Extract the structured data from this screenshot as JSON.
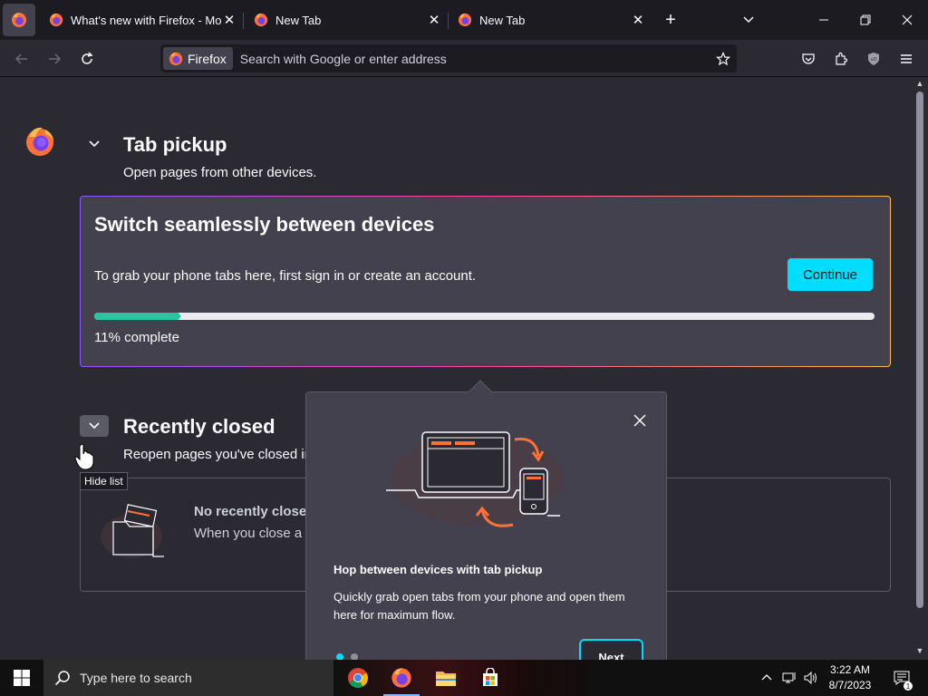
{
  "tabs": [
    {
      "title": "What's new with Firefox - More",
      "close": "✕"
    },
    {
      "title": "New Tab",
      "close": "✕"
    },
    {
      "title": "New Tab",
      "close": "✕"
    }
  ],
  "tabstrip": {
    "new_tab": "+",
    "list_tabs": "⌄"
  },
  "window": {
    "minimize": "—",
    "restore": "❐",
    "close": "✕"
  },
  "navbar": {
    "identity_label": "Firefox",
    "url_placeholder": "Search with Google or enter address",
    "url_value": ""
  },
  "tab_pickup": {
    "title": "Tab pickup",
    "subtitle": "Open pages from other devices.",
    "card_title": "Switch seamlessly between devices",
    "card_text": "To grab your phone tabs here, first sign in or create an account.",
    "continue_label": "Continue",
    "progress_text": "11% complete",
    "progress_fraction": 0.11
  },
  "recently_closed": {
    "title": "Recently closed",
    "subtitle": "Reopen pages you've closed in",
    "empty_title": "No recently closed",
    "empty_sub": "When you close a t"
  },
  "tooltip": "Hide list",
  "popup": {
    "title": "Hop between devices with tab pickup",
    "body": "Quickly grab open tabs from your phone and open them here for maximum flow.",
    "next_label": "Next",
    "step": 1,
    "steps": 2
  },
  "taskbar": {
    "search_placeholder": "Type here to search",
    "time": "3:22 AM",
    "date": "8/7/2023"
  },
  "colors": {
    "accent": "#00ddff",
    "progress": "#2ac3a2",
    "firefox_orange": "#ff7139"
  }
}
